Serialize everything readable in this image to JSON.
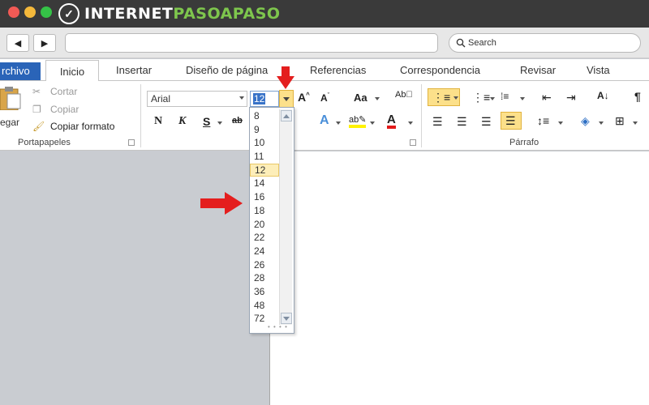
{
  "watermark": {
    "brand_main": "INTERNET",
    "brand_accent": "PASOAPASO",
    "color_main": "#ffffff",
    "color_accent": "#7ec64d"
  },
  "browser": {
    "search_label": "Search"
  },
  "ribbon_tabs": {
    "archivo": "rchivo",
    "inicio": "Inicio",
    "insertar": "Insertar",
    "diseno": "Diseño de página",
    "referencias": "Referencias",
    "correspondencia": "Correspondencia",
    "revisar": "Revisar",
    "vista": "Vista"
  },
  "clipboard": {
    "paste_label": "egar",
    "cut_label": "Cortar",
    "copy_label": "Copiar",
    "format_painter_label": "Copiar formato",
    "group_label": "Portapapeles"
  },
  "font": {
    "name": "Arial",
    "size": "12",
    "bold_label": "N",
    "italic_label": "K",
    "underline_label": "S"
  },
  "paragraph": {
    "group_label": "Párrafo"
  },
  "font_sizes": [
    "8",
    "9",
    "10",
    "11",
    "12",
    "14",
    "16",
    "18",
    "20",
    "22",
    "24",
    "26",
    "28",
    "36",
    "48",
    "72"
  ],
  "selected_size": "12",
  "colors": {
    "accent_highlight": "#fce08a",
    "annotation_arrow": "#e41e1e",
    "archivo_tab": "#2a64b8"
  }
}
